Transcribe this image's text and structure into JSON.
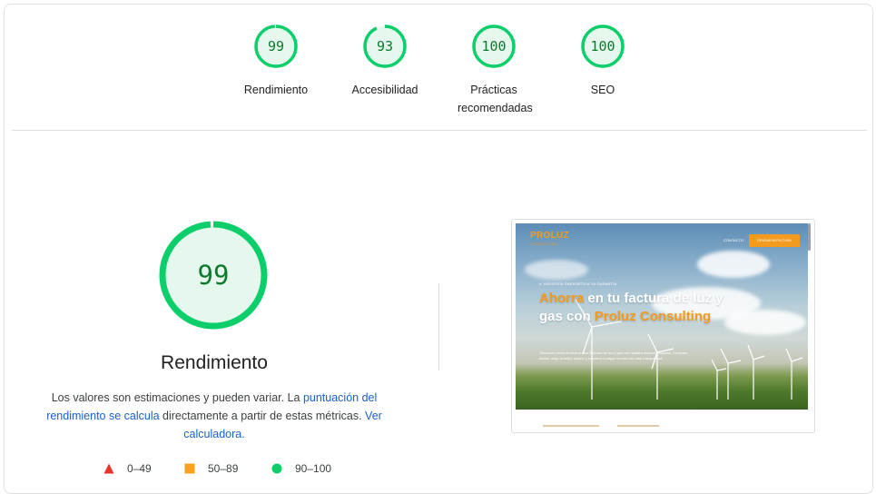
{
  "summary_gauges": [
    {
      "score": "99",
      "label": "Rendimiento",
      "fraction": 0.99
    },
    {
      "score": "93",
      "label": "Accesibilidad",
      "fraction": 0.93
    },
    {
      "score": "100",
      "label": "Prácticas recomendadas",
      "fraction": 1.0
    },
    {
      "score": "100",
      "label": "SEO",
      "fraction": 1.0
    }
  ],
  "main": {
    "score": "99",
    "fraction": 0.99,
    "title": "Rendimiento",
    "desc_part1": "Los valores son estimaciones y pueden variar. La ",
    "desc_link1": "puntuación del rendimiento se calcula",
    "desc_part2": " directamente a partir de estas métricas. ",
    "desc_link2": "Ver calculadora."
  },
  "legend": [
    {
      "range": "0–49",
      "color": "#e8332f",
      "icon": "triangle-icon"
    },
    {
      "range": "50–89",
      "color": "#f7a11c",
      "icon": "square-icon"
    },
    {
      "range": "90–100",
      "color": "#0cce6b",
      "icon": "circle-icon"
    }
  ],
  "colors": {
    "pass_stroke": "#0cce6b",
    "pass_fill": "#e6f8ee",
    "pass_text": "#0b7a2c",
    "link": "#1a5fd0",
    "brand_orange": "#f39b1f"
  },
  "screenshot": {
    "logo": "PROLUZ",
    "logo_sub": "CONSULTING",
    "nav_link": "CONTACTO",
    "cta": "REVISAR MI FACTURA",
    "pre_title": "✔ ASESORÍA ENERGÉTICA YA GARANTÍA",
    "headline_orange": "Ahorra",
    "headline_white1": " en tu factura de luz y gas con ",
    "headline_brand": "Proluz Consulting",
    "paragraph": "Descubre cómo ahorrar en tus facturas de luz y gas con nuestra asesoría experta. Compara tarifas, elige la mejor opción y empieza a pagar menos con total tranquilidad."
  }
}
